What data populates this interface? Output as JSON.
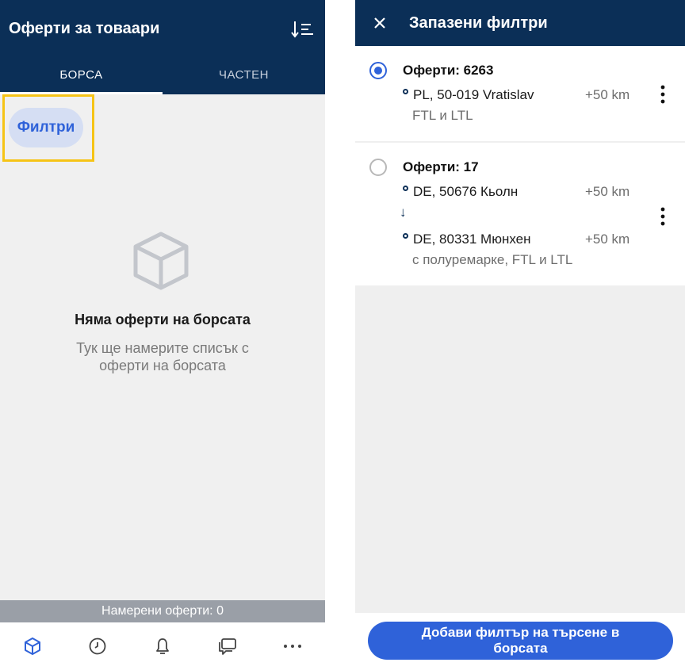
{
  "left": {
    "header": {
      "title": "Оферти за товаари",
      "sort_icon": "sort-icon"
    },
    "tabs": [
      {
        "label": "БОРСА",
        "active": true
      },
      {
        "label": "ЧАСТЕН",
        "active": false
      }
    ],
    "filter_chip": {
      "label": "Филтри",
      "highlight_color": "#f6c416"
    },
    "empty_state": {
      "icon": "box-icon",
      "title": "Няма оферти на борсата",
      "text": "Тук ще намерите списък с оферти на борсата"
    },
    "found_bar": {
      "text": "Намерени оферти: 0"
    },
    "bottom_nav": [
      {
        "icon": "box-icon",
        "active": true
      },
      {
        "icon": "clock-icon",
        "active": false
      },
      {
        "icon": "bell-icon",
        "active": false
      },
      {
        "icon": "chat-icon",
        "active": false
      },
      {
        "icon": "more-icon",
        "active": false
      }
    ]
  },
  "right": {
    "header": {
      "title": "Запазени филтри",
      "close_icon": "close-icon"
    },
    "filters": [
      {
        "selected": true,
        "offers": "Оферти: 6263",
        "from": "PL, 50-019 Vratislav",
        "from_radius": "+50 km",
        "details": "FTL и LTL"
      },
      {
        "selected": false,
        "offers": "Оферти: 17",
        "from": "DE, 50676 Кьолн",
        "from_radius": "+50 km",
        "to": "DE, 80331 Мюнхен",
        "to_radius": "+50 km",
        "details": "с полуремарке, FTL и LTL"
      }
    ],
    "add_button": {
      "label": "Добави филтър на търсене в борсата"
    }
  },
  "colors": {
    "header_navy": "#0b2f57",
    "accent_blue": "#2f62d9",
    "chip_bg": "#d5def3",
    "highlight_yellow": "#f6c416"
  }
}
